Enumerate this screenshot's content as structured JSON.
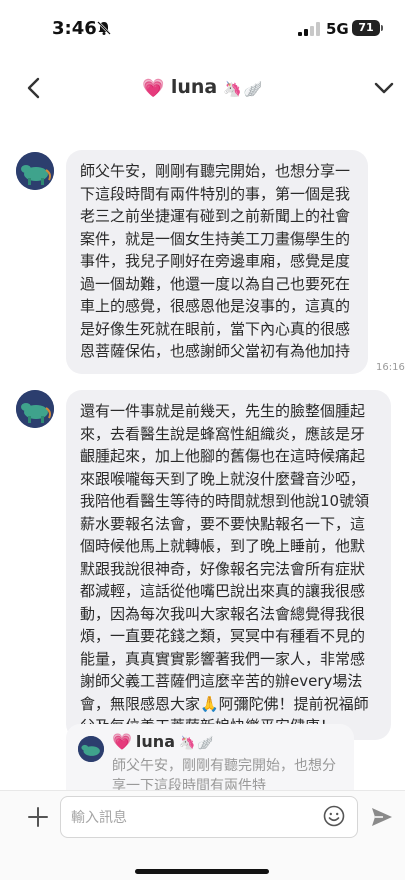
{
  "status_bar": {
    "time": "3:46",
    "network": "5G",
    "battery": "71"
  },
  "header": {
    "heart": "💗",
    "name": "luna",
    "unicorn": "🦄",
    "wing": "🪽"
  },
  "messages": [
    {
      "text": "師父午安，剛剛有聽完開始，也想分享一下這段時間有兩件特別的事，第一個是我老三之前坐捷運有碰到之前新聞上的社會案件，就是一個女生持美工刀畫傷學生的事件，我兒子剛好在旁邊車廂，感覺是度過一個劫難，他還一度以為自己也要死在車上的感覺，很感恩他是沒事的，這真的是好像生死就在眼前，當下內心真的很感恩菩薩保佑，也感謝師父當初有為他加持",
      "time": "16:16"
    },
    {
      "text": "還有一件事就是前幾天，先生的臉整個腫起來，去看醫生說是蜂窩性組織炎，應該是牙齦腫起來，加上他腳的舊傷也在這時候痛起來跟喉嚨每天到了晚上就沒什麼聲音沙啞，我陪他看醫生等待的時間就想到他說10號領薪水要報名法會，要不要快點報名一下，這個時候他馬上就轉帳，到了晚上睡前，他默默跟我說很神奇，好像報名完法會所有症狀都減輕，這話從他嘴巴說出來真的讓我很感動，因為每次我叫大家報名法會總覺得我很煩，一直要花錢之類，冥冥中有種看不見的能量，真真實實影響著我們一家人，非常感謝師父義工菩薩們這麼辛苦的辦every場法會，無限感恩大家🙏阿彌陀佛！提前祝福師父及每位義工菩薩新娘快樂平安健康！"
    }
  ],
  "reply_preview": {
    "heart": "💗",
    "name": "luna",
    "unicorn": "🦄",
    "wing": "🪽",
    "text": "師父午安，剛剛有聽完開始，也想分享一下這段時間有兩件特"
  },
  "composer": {
    "placeholder": "輸入訊息"
  },
  "icons": {
    "back": "chevron-left-icon",
    "menu": "chevron-down-icon",
    "attach": "plus-icon",
    "emoji": "smiley-icon",
    "send": "send-icon"
  }
}
